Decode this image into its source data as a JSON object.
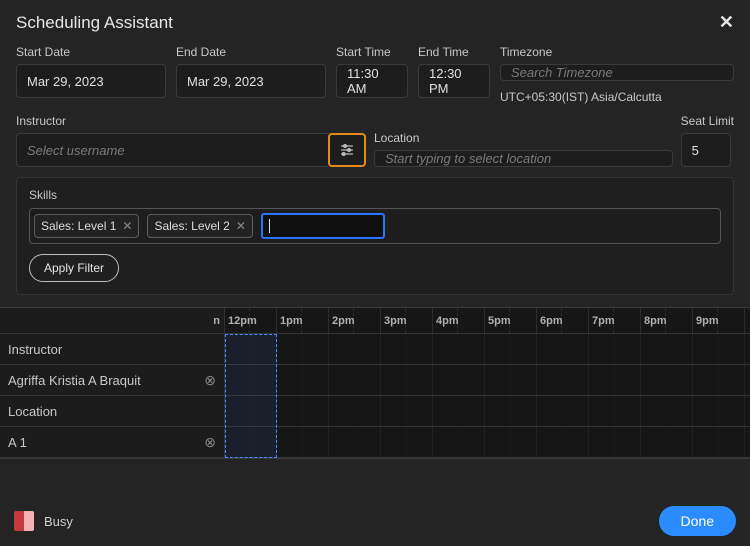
{
  "header": {
    "title": "Scheduling Assistant"
  },
  "fields": {
    "start_date": {
      "label": "Start Date",
      "value": "Mar 29, 2023"
    },
    "end_date": {
      "label": "End Date",
      "value": "Mar 29, 2023"
    },
    "start_time": {
      "label": "Start Time",
      "value": "11:30 AM"
    },
    "end_time": {
      "label": "End Time",
      "value": "12:30 PM"
    },
    "timezone": {
      "label": "Timezone",
      "placeholder": "Search Timezone",
      "note": "UTC+05:30(IST) Asia/Calcutta"
    },
    "instructor": {
      "label": "Instructor",
      "placeholder": "Select username"
    },
    "location": {
      "label": "Location",
      "placeholder": "Start typing to select location"
    },
    "seat_limit": {
      "label": "Seat Limit",
      "value": "5"
    }
  },
  "skills": {
    "label": "Skills",
    "chips": [
      "Sales: Level 1",
      "Sales: Level 2"
    ],
    "apply_label": "Apply Filter"
  },
  "grid": {
    "partial_hour": "n",
    "hours": [
      "12pm",
      "1pm",
      "2pm",
      "3pm",
      "4pm",
      "5pm",
      "6pm",
      "7pm",
      "8pm",
      "9pm"
    ],
    "rows": [
      {
        "label": "Instructor",
        "removable": false
      },
      {
        "label": "Agriffa Kristia A Braquit",
        "removable": true
      },
      {
        "label": "Location",
        "removable": false
      },
      {
        "label": "A 1",
        "removable": true
      }
    ]
  },
  "legend": {
    "busy": "Busy"
  },
  "buttons": {
    "done": "Done"
  }
}
